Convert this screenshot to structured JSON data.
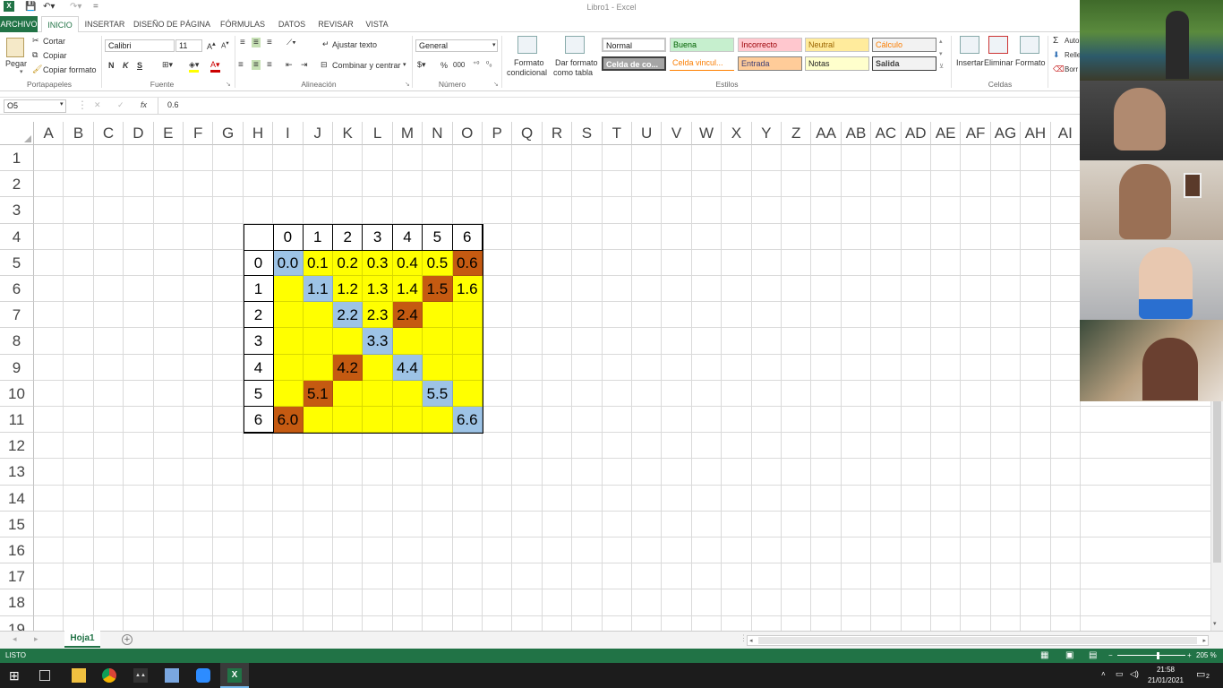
{
  "window": {
    "title": "Libro1 - Excel"
  },
  "tabs": [
    "ARCHIVO",
    "INICIO",
    "INSERTAR",
    "DISEÑO DE PÁGINA",
    "FÓRMULAS",
    "DATOS",
    "REVISAR",
    "VISTA"
  ],
  "ribbon": {
    "paste": "Pegar",
    "cut": "Cortar",
    "copy": "Copiar",
    "format_painter": "Copiar formato",
    "clipboard_group": "Portapapeles",
    "font_name": "Calibri",
    "font_size": "11",
    "bold": "N",
    "italic": "K",
    "underline": "S",
    "font_group": "Fuente",
    "wrap_text": "Ajustar texto",
    "merge_center": "Combinar y centrar",
    "alignment_group": "Alineación",
    "number_format": "General",
    "percent": "%",
    "thousands": "000",
    "number_group": "Número",
    "cond_format_1": "Formato",
    "cond_format_2": "condicional",
    "table_format_1": "Dar formato",
    "table_format_2": "como tabla",
    "styles": {
      "normal": "Normal",
      "good": "Buena",
      "bad": "Incorrecto",
      "neutral": "Neutral",
      "calc": "Cálculo",
      "check_cell": "Celda de co...",
      "linked_cell": "Celda vincul...",
      "input": "Entrada",
      "notes": "Notas",
      "output": "Salida"
    },
    "styles_group": "Estilos",
    "insert": "Insertar",
    "delete": "Eliminar",
    "format": "Formato",
    "cells_group": "Celdas",
    "autosum": "Auto",
    "fill": "Relle",
    "clear": "Borr"
  },
  "formula_bar": {
    "name_box": "O5",
    "fx": "fx",
    "value": "0.6"
  },
  "columns": [
    "A",
    "B",
    "C",
    "D",
    "E",
    "F",
    "G",
    "H",
    "I",
    "J",
    "K",
    "L",
    "M",
    "N",
    "O",
    "P",
    "Q",
    "R",
    "S",
    "T",
    "U",
    "V",
    "W",
    "X",
    "Y",
    "Z",
    "AA",
    "AB",
    "AC",
    "AD",
    "AE",
    "AF",
    "AG",
    "AH",
    "AI"
  ],
  "rows": [
    "1",
    "2",
    "3",
    "4",
    "5",
    "6",
    "7",
    "8",
    "9",
    "10",
    "11",
    "12",
    "13",
    "14",
    "15",
    "16",
    "17",
    "18",
    "19"
  ],
  "table": {
    "col_headers": [
      "0",
      "1",
      "2",
      "3",
      "4",
      "5",
      "6"
    ],
    "row_headers": [
      "0",
      "1",
      "2",
      "3",
      "4",
      "5",
      "6"
    ],
    "cells": [
      [
        {
          "v": "0.0",
          "c": "blue"
        },
        {
          "v": "0.1",
          "c": "yellow"
        },
        {
          "v": "0.2",
          "c": "yellow"
        },
        {
          "v": "0.3",
          "c": "yellow"
        },
        {
          "v": "0.4",
          "c": "yellow"
        },
        {
          "v": "0.5",
          "c": "yellow"
        },
        {
          "v": "0.6",
          "c": "orange"
        }
      ],
      [
        {
          "v": "",
          "c": "yellow"
        },
        {
          "v": "1.1",
          "c": "blue"
        },
        {
          "v": "1.2",
          "c": "yellow"
        },
        {
          "v": "1.3",
          "c": "yellow"
        },
        {
          "v": "1.4",
          "c": "yellow"
        },
        {
          "v": "1.5",
          "c": "orange"
        },
        {
          "v": "1.6",
          "c": "yellow"
        }
      ],
      [
        {
          "v": "",
          "c": "yellow"
        },
        {
          "v": "",
          "c": "yellow"
        },
        {
          "v": "2.2",
          "c": "blue"
        },
        {
          "v": "2.3",
          "c": "yellow"
        },
        {
          "v": "2.4",
          "c": "orange"
        },
        {
          "v": "",
          "c": "yellow"
        },
        {
          "v": "",
          "c": "yellow"
        }
      ],
      [
        {
          "v": "",
          "c": "yellow"
        },
        {
          "v": "",
          "c": "yellow"
        },
        {
          "v": "",
          "c": "yellow"
        },
        {
          "v": "3.3",
          "c": "blue"
        },
        {
          "v": "",
          "c": "yellow"
        },
        {
          "v": "",
          "c": "yellow"
        },
        {
          "v": "",
          "c": "yellow"
        }
      ],
      [
        {
          "v": "",
          "c": "yellow"
        },
        {
          "v": "",
          "c": "yellow"
        },
        {
          "v": "4.2",
          "c": "orange"
        },
        {
          "v": "",
          "c": "yellow"
        },
        {
          "v": "4.4",
          "c": "blue"
        },
        {
          "v": "",
          "c": "yellow"
        },
        {
          "v": "",
          "c": "yellow"
        }
      ],
      [
        {
          "v": "",
          "c": "yellow"
        },
        {
          "v": "5.1",
          "c": "orange"
        },
        {
          "v": "",
          "c": "yellow"
        },
        {
          "v": "",
          "c": "yellow"
        },
        {
          "v": "",
          "c": "yellow"
        },
        {
          "v": "5.5",
          "c": "blue"
        },
        {
          "v": "",
          "c": "yellow"
        }
      ],
      [
        {
          "v": "6.0",
          "c": "orange"
        },
        {
          "v": "",
          "c": "yellow"
        },
        {
          "v": "",
          "c": "yellow"
        },
        {
          "v": "",
          "c": "yellow"
        },
        {
          "v": "",
          "c": "yellow"
        },
        {
          "v": "",
          "c": "yellow"
        },
        {
          "v": "6.6",
          "c": "blue"
        }
      ]
    ]
  },
  "colors": {
    "yellow": "#ffff00",
    "blue": "#9dc3e6",
    "orange": "#c55a11",
    "excel_green": "#217346"
  },
  "sheet_tab": "Hoja1",
  "status": {
    "mode": "LISTO",
    "zoom": "205 %"
  },
  "taskbar": {
    "time": "21:58",
    "date": "21/01/2021",
    "notifications": "2"
  }
}
